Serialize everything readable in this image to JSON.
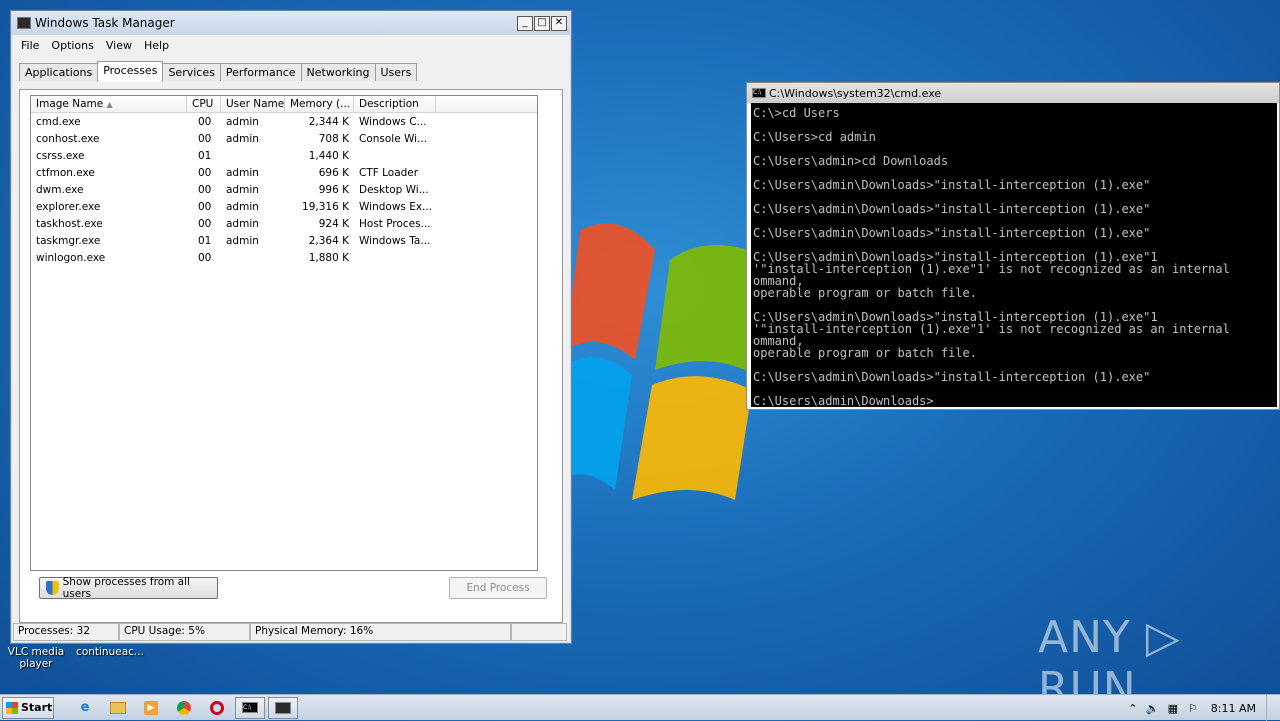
{
  "task_manager": {
    "title": "Windows Task Manager",
    "menu": [
      "File",
      "Options",
      "View",
      "Help"
    ],
    "tabs": [
      "Applications",
      "Processes",
      "Services",
      "Performance",
      "Networking",
      "Users"
    ],
    "active_tab": "Processes",
    "columns": [
      "Image Name",
      "CPU",
      "User Name",
      "Memory (...",
      "Description"
    ],
    "rows": [
      {
        "name": "cmd.exe",
        "cpu": "00",
        "user": "admin",
        "mem": "2,344 K",
        "desc": "Windows C..."
      },
      {
        "name": "conhost.exe",
        "cpu": "00",
        "user": "admin",
        "mem": "708 K",
        "desc": "Console Wi..."
      },
      {
        "name": "csrss.exe",
        "cpu": "01",
        "user": "",
        "mem": "1,440 K",
        "desc": ""
      },
      {
        "name": "ctfmon.exe",
        "cpu": "00",
        "user": "admin",
        "mem": "696 K",
        "desc": "CTF Loader"
      },
      {
        "name": "dwm.exe",
        "cpu": "00",
        "user": "admin",
        "mem": "996 K",
        "desc": "Desktop Wi..."
      },
      {
        "name": "explorer.exe",
        "cpu": "00",
        "user": "admin",
        "mem": "19,316 K",
        "desc": "Windows Ex..."
      },
      {
        "name": "taskhost.exe",
        "cpu": "00",
        "user": "admin",
        "mem": "924 K",
        "desc": "Host Proces..."
      },
      {
        "name": "taskmgr.exe",
        "cpu": "01",
        "user": "admin",
        "mem": "2,364 K",
        "desc": "Windows Ta..."
      },
      {
        "name": "winlogon.exe",
        "cpu": "00",
        "user": "",
        "mem": "1,880 K",
        "desc": ""
      }
    ],
    "show_all_label": "Show processes from all users",
    "end_process_label": "End Process",
    "status": {
      "processes": "Processes: 32",
      "cpu": "CPU Usage: 5%",
      "memory": "Physical Memory: 16%"
    }
  },
  "desktop_labels": {
    "vlc": "VLC media player",
    "continue": "continueac..."
  },
  "cmd": {
    "title": "C:\\Windows\\system32\\cmd.exe",
    "output": "C:\\>cd Users\n\nC:\\Users>cd admin\n\nC:\\Users\\admin>cd Downloads\n\nC:\\Users\\admin\\Downloads>\"install-interception (1).exe\"\n\nC:\\Users\\admin\\Downloads>\"install-interception (1).exe\"\n\nC:\\Users\\admin\\Downloads>\"install-interception (1).exe\"\n\nC:\\Users\\admin\\Downloads>\"install-interception (1).exe\"1\n'\"install-interception (1).exe\"1' is not recognized as an internal\nommand,\noperable program or batch file.\n\nC:\\Users\\admin\\Downloads>\"install-interception (1).exe\"1\n'\"install-interception (1).exe\"1' is not recognized as an internal\nommand,\noperable program or batch file.\n\nC:\\Users\\admin\\Downloads>\"install-interception (1).exe\"\n\nC:\\Users\\admin\\Downloads>"
  },
  "watermark": "ANY ▷ RUN",
  "taskbar": {
    "start_label": "Start",
    "clock": "8:11 AM",
    "icons": [
      "ie-icon",
      "folder-icon",
      "media-player-icon",
      "chrome-icon",
      "opera-icon",
      "cmd-icon",
      "task-manager-icon"
    ]
  }
}
